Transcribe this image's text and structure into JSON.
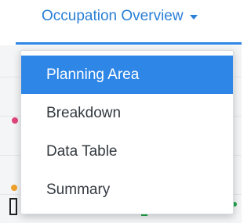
{
  "tab": {
    "label": "Occupation Overview",
    "caret_icon": "caret-down-icon",
    "accent_color": "#2e86e6"
  },
  "dropdown": {
    "items": [
      {
        "label": "Planning Area",
        "active": true
      },
      {
        "label": "Breakdown",
        "active": false
      },
      {
        "label": "Data Table",
        "active": false
      },
      {
        "label": "Summary",
        "active": false
      }
    ],
    "active_color": "#2e86e6"
  }
}
